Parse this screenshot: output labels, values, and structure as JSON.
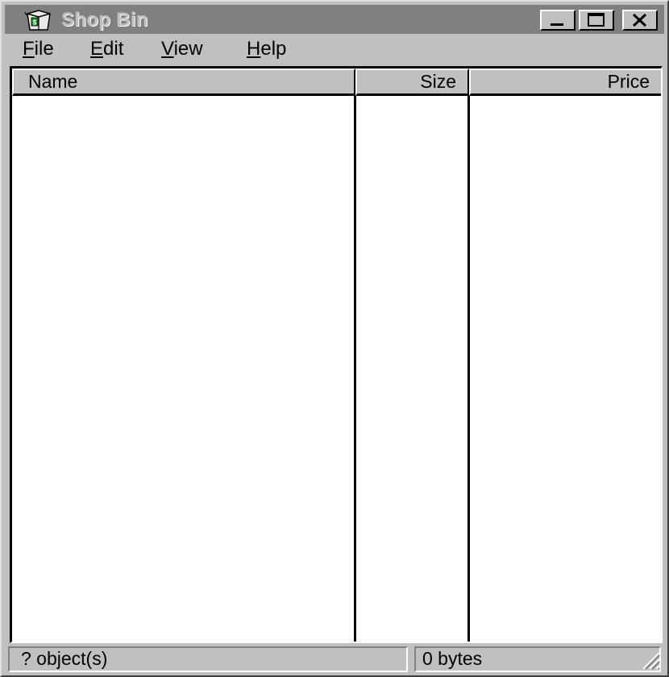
{
  "window": {
    "title": "Shop Bin",
    "icon": "recycle-bin-icon"
  },
  "title_buttons": {
    "minimize": "minimize-icon",
    "maximize": "maximize-icon",
    "close": "close-icon"
  },
  "menu": [
    {
      "accel": "F",
      "rest": "ile"
    },
    {
      "accel": "E",
      "rest": "dit"
    },
    {
      "accel": "V",
      "rest": "iew"
    },
    {
      "accel": "H",
      "rest": "elp"
    }
  ],
  "columns": [
    "Name",
    "Size",
    "Price"
  ],
  "rows": [],
  "status": {
    "objects": "? object(s)",
    "bytes": "0 bytes"
  },
  "colors": {
    "face": "#c0c0c0",
    "titlebar_inactive": "#808080",
    "title_text": "#c0c0c0",
    "list_bg": "#ffffff"
  }
}
